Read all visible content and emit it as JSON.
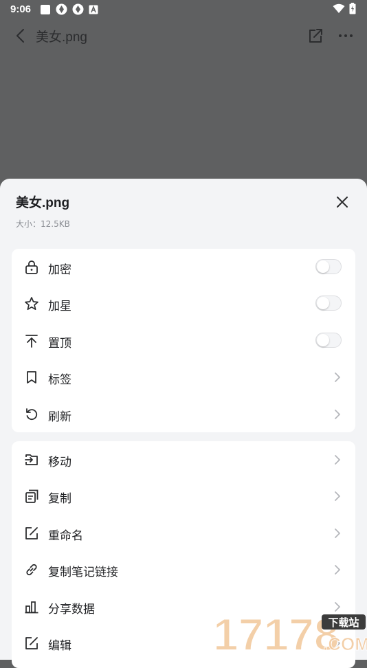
{
  "status_bar": {
    "time": "9:06"
  },
  "app_bar": {
    "title": "美女.png"
  },
  "sheet": {
    "title": "美女.png",
    "size": "大小：12.5KB"
  },
  "toggle_options": [
    {
      "icon": "lock-icon",
      "label": "加密",
      "on": false
    },
    {
      "icon": "star-icon",
      "label": "加星",
      "on": false
    },
    {
      "icon": "pin-top-icon",
      "label": "置顶",
      "on": false
    }
  ],
  "nav_options_1": [
    {
      "icon": "bookmark-icon",
      "label": "标签"
    },
    {
      "icon": "refresh-icon",
      "label": "刷新"
    }
  ],
  "nav_options_2": [
    {
      "icon": "move-icon",
      "label": "移动"
    },
    {
      "icon": "copy-icon",
      "label": "复制"
    },
    {
      "icon": "rename-icon",
      "label": "重命名"
    },
    {
      "icon": "link-icon",
      "label": "复制笔记链接"
    },
    {
      "icon": "chart-icon",
      "label": "分享数据"
    },
    {
      "icon": "edit-icon",
      "label": "编辑"
    }
  ],
  "watermark": {
    "number": "17178",
    "site": "下载站",
    "suffix": ".COM"
  },
  "colors": {
    "overlay": "#5f6061",
    "sheet_bg": "#f3f4f6",
    "card_bg": "#ffffff",
    "text": "#1e1f22",
    "muted": "#8a8d93"
  }
}
